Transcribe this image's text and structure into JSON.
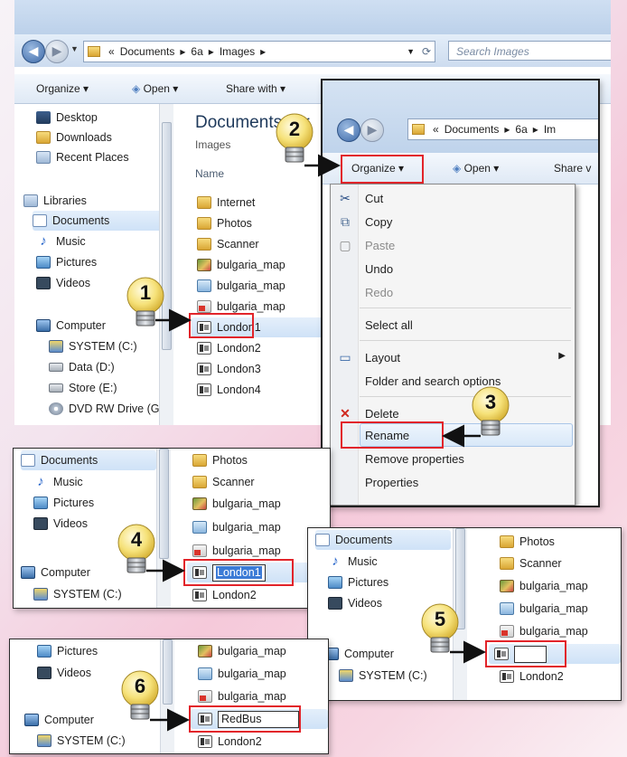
{
  "main_window": {
    "address": [
      "«",
      "Documents",
      "6a",
      "Images"
    ],
    "search_placeholder": "Search Images",
    "toolbar": {
      "organize": "Organize",
      "open": "Open",
      "share_with": "Share with"
    },
    "nav": {
      "favorites": [
        "Desktop",
        "Downloads",
        "Recent Places"
      ],
      "libraries_header": "Libraries",
      "libraries": [
        "Documents",
        "Music",
        "Pictures",
        "Videos"
      ],
      "computer_header": "Computer",
      "drives": [
        "SYSTEM (C:)",
        "Data (D:)",
        "Store (E:)",
        "DVD RW Drive (G"
      ]
    },
    "content": {
      "library_title": "Documents libr",
      "library_subtitle": "Images",
      "name_column": "Name",
      "files": [
        "Internet",
        "Photos",
        "Scanner",
        "bulgaria_map",
        "bulgaria_map",
        "bulgaria_map",
        "London1",
        "London2",
        "London3",
        "London4"
      ]
    }
  },
  "menu_window": {
    "address": [
      "«",
      "Documents",
      "6a",
      "Im"
    ],
    "toolbar": {
      "organize": "Organize",
      "open": "Open",
      "share_with": "Share v"
    },
    "menu_items": [
      "Cut",
      "Copy",
      "Paste",
      "Undo",
      "Redo",
      "Select all",
      "Layout",
      "Folder and search options",
      "Delete",
      "Rename",
      "Remove properties",
      "Properties"
    ]
  },
  "step4": {
    "nav": [
      "Documents",
      "Music",
      "Pictures",
      "Videos",
      "Computer",
      "SYSTEM (C:)"
    ],
    "files": [
      "Photos",
      "Scanner",
      "bulgaria_map",
      "bulgaria_map",
      "bulgaria_map",
      "London1",
      "London2"
    ]
  },
  "step5": {
    "nav": [
      "Documents",
      "Music",
      "Pictures",
      "Videos",
      "Computer",
      "SYSTEM (C:)"
    ],
    "files": [
      "Photos",
      "Scanner",
      "bulgaria_map",
      "bulgaria_map",
      "bulgaria_map",
      "",
      "London2"
    ]
  },
  "step6": {
    "nav": [
      "Pictures",
      "Videos",
      "Computer",
      "SYSTEM (C:)"
    ],
    "files": [
      "bulgaria_map",
      "bulgaria_map",
      "bulgaria_map",
      "RedBus",
      "London2"
    ]
  },
  "step_numbers": [
    "1",
    "2",
    "3",
    "4",
    "5",
    "6"
  ],
  "colors": {
    "highlight_red": "#e2242a",
    "selection_blue": "#3b7bd6",
    "bulb_yellow": "#f6e27a"
  }
}
